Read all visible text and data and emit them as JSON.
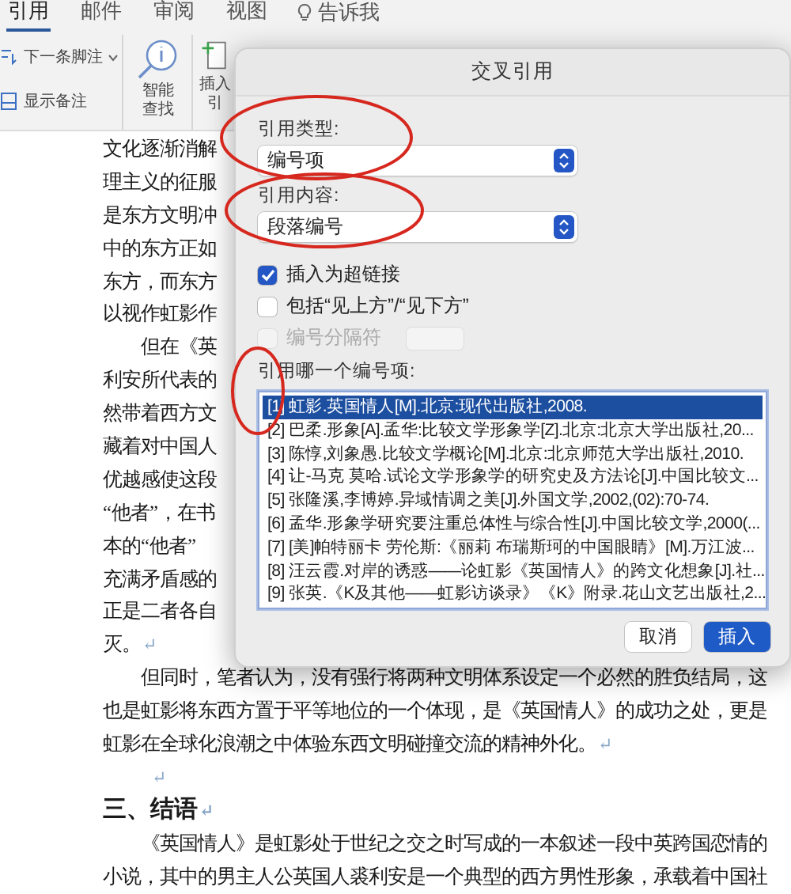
{
  "ribbon": {
    "tabs": [
      {
        "label": "引用",
        "selected": true
      },
      {
        "label": "邮件",
        "selected": false
      },
      {
        "label": "审阅",
        "selected": false
      },
      {
        "label": "视图",
        "selected": false
      }
    ],
    "tell_me": "告诉我",
    "footnote_next": "下一条脚注",
    "show_notes": "显示备注",
    "smart_lookup": [
      "智能",
      "查找"
    ],
    "insert_citation": [
      "插入",
      "引"
    ]
  },
  "document": {
    "upper_lines": [
      {
        "text": "文化逐渐消解"
      },
      {
        "text": "理主义的征服"
      },
      {
        "text": "是东方文明冲"
      },
      {
        "text": "中的东方正如"
      },
      {
        "text": "东方，而东方"
      },
      {
        "text": "以视作虹影作"
      },
      {
        "text": "　　但在《英"
      },
      {
        "text": "利安所代表的"
      },
      {
        "text": "然带着西方文"
      },
      {
        "text": "藏着对中国人"
      },
      {
        "text": "优越感使这段"
      },
      {
        "text": "“他者”，在书"
      },
      {
        "text": "本的“他者”"
      },
      {
        "text": "充满矛盾感的"
      },
      {
        "text": "正是二者各自"
      },
      {
        "text": "灭。",
        "mark": "↵"
      }
    ],
    "lines": [
      {
        "kind": "body",
        "text": "　　但同时，笔者认为，没有强行将两种文明体系设定一个必然的胜负结局，这"
      },
      {
        "kind": "body",
        "text": "也是虹影将东西方置于平等地位的一个体现，是《英国情人》的成功之处，更是"
      },
      {
        "kind": "body",
        "text": "虹影在全球化浪潮之中体验东西文明碰撞交流的精神外化。",
        "mark": "↵"
      },
      {
        "kind": "empty",
        "mark": "↵"
      },
      {
        "kind": "heading",
        "text": "三、结语",
        "mark": "↵"
      },
      {
        "kind": "body",
        "text": "　　《英国情人》是虹影处于世纪之交之时写成的一本叙述一段中英跨国恋情的"
      },
      {
        "kind": "body",
        "text": "小说，其中的男主人公英国人裘利安是一个典型的西方男性形象，承载着中国社"
      }
    ]
  },
  "dialog": {
    "title": "交叉引用",
    "reference_type_label": "引用类型:",
    "reference_type": "编号项",
    "reference_content_label": "引用内容:",
    "reference_content": "段落编号",
    "options": [
      {
        "label": "插入为超链接",
        "checked": true,
        "disabled": false
      },
      {
        "label": "包括“见上方”/“见下方”",
        "checked": false,
        "disabled": false
      },
      {
        "label": "编号分隔符",
        "checked": false,
        "disabled": true
      }
    ],
    "list_label": "引用哪一个编号项:",
    "items": [
      {
        "text": "[1] 虹影.英国情人[M].北京:现代出版社,2008.",
        "selected": true
      },
      {
        "text": "[2] 巴柔.形象[A].孟华:比较文学形象学[Z].北京:北京大学出版社,20...",
        "selected": false
      },
      {
        "text": "[3] 陈惇,刘象愚.比较文学概论[M].北京:北京师范大学出版社,2010.",
        "selected": false
      },
      {
        "text": "[4] 让-马克 莫哈.试论文学形象学的研究史及方法论[J].中国比较文...",
        "selected": false
      },
      {
        "text": "[5] 张隆溪,李博婷.异域情调之美[J].外国文学,2002,(02):70-74.",
        "selected": false
      },
      {
        "text": "[6] 孟华.形象学研究要注重总体性与综合性[J].中国比较文学,2000(...",
        "selected": false
      },
      {
        "text": "[7] [美]帕特丽卡 劳伦斯:《丽莉 布瑞斯珂的中国眼睛》[M].万江波...",
        "selected": false
      },
      {
        "text": "[8] 汪云霞.对岸的诱惑——论虹影《英国情人》的跨文化想象[J].社...",
        "selected": false
      },
      {
        "text": "[9] 张英.《K及其他——虹影访谈录》《K》附录.花山文艺出版社,2...",
        "selected": false
      }
    ],
    "buttons": [
      {
        "label": "取消",
        "kind": "secondary"
      },
      {
        "label": "插入",
        "kind": "primary"
      }
    ]
  },
  "annotations": [
    {
      "kind": "ellipse"
    },
    {
      "kind": "ellipse"
    },
    {
      "kind": "ellipse"
    }
  ]
}
